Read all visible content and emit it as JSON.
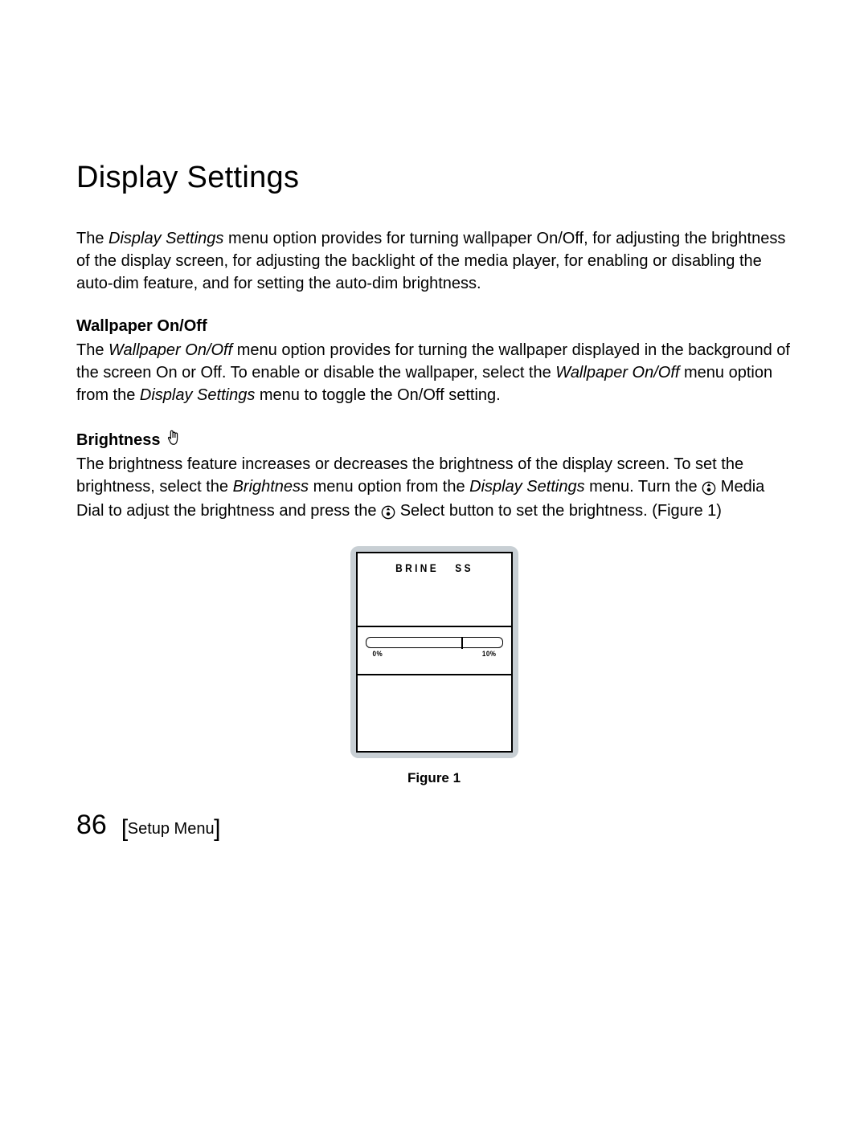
{
  "title": "Display Settings",
  "intro": {
    "pre": "The ",
    "em1": "Display Settings",
    "post": " menu option provides for turning wallpaper On/Off, for adjusting the brightness of the display screen, for adjusting the backlight of the media player, for enabling or disabling the auto-dim feature, and for setting the auto-dim brightness."
  },
  "wallpaper": {
    "heading": "Wallpaper On/Off",
    "t1": "The ",
    "em1": "Wallpaper On/Off",
    "t2": " menu option provides for turning the wallpaper displayed in the background of the screen On or Off. To enable or disable the wallpaper, select the ",
    "em2": "Wallpaper On/Off",
    "t3": " menu option from the ",
    "em3": "Display Settings",
    "t4": " menu to toggle the On/Off setting."
  },
  "brightness": {
    "heading": "Brightness",
    "t1": "The brightness feature increases or decreases the brightness of the display screen. To set the brightness, select the ",
    "em1": "Brightness",
    "t2": " menu option from the ",
    "em2": "Display Settings",
    "t3": " menu. Turn the ",
    "t4": " Media Dial to adjust the brightness and press the ",
    "t5": " Select button to set the brightness. (Figure 1)"
  },
  "figure": {
    "screen_title_left": "BRINE",
    "screen_title_right": "SS",
    "slider_min": "0%",
    "slider_max": "10%",
    "caption": "Figure 1"
  },
  "footer": {
    "page_number": "86",
    "bracket_open": "[",
    "section": "Setup Menu",
    "bracket_close": "]"
  }
}
